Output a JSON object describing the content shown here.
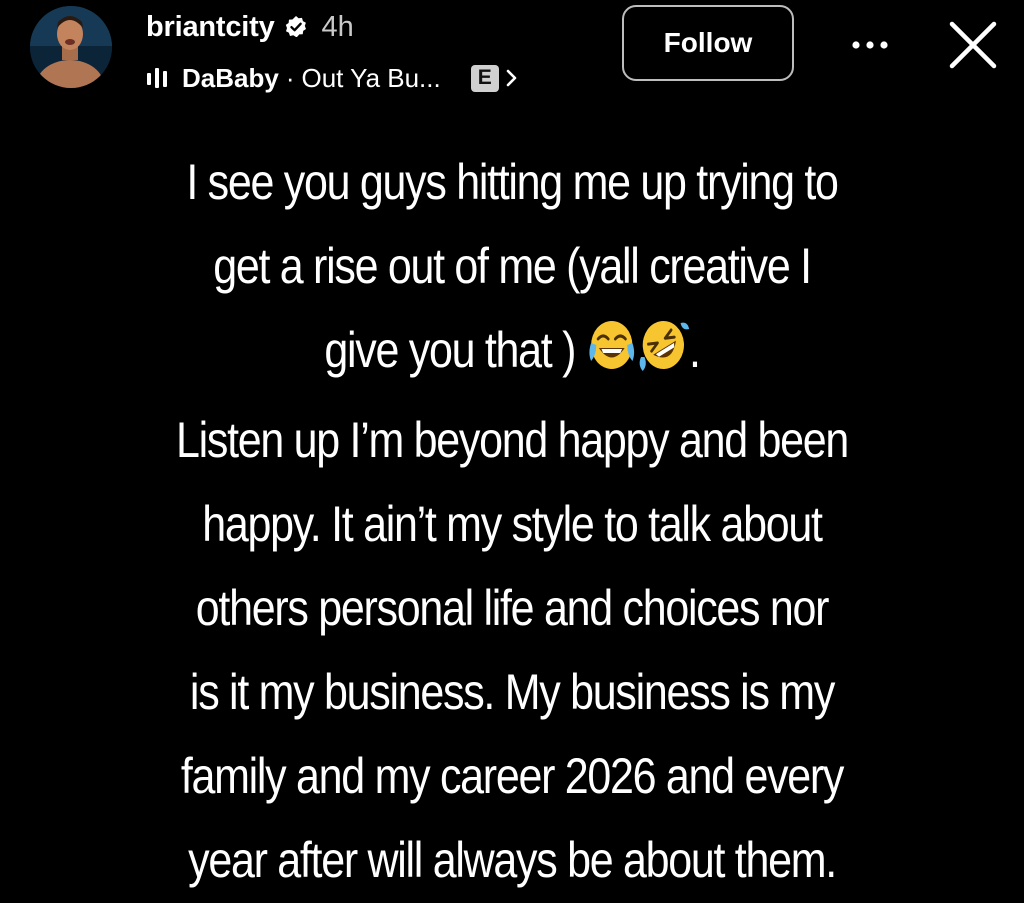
{
  "header": {
    "username": "briantcity",
    "time_ago": "4h",
    "follow_label": "Follow",
    "verified_icon": "verified-badge-icon",
    "more_icon": "more-options-icon",
    "close_icon": "close-icon"
  },
  "music": {
    "icon": "music-bars-icon",
    "artist": "DaBaby",
    "separator": "·",
    "track": "Out Ya Bu...",
    "explicit_badge": "E",
    "chevron_icon": "chevron-right-icon"
  },
  "story": {
    "lines": [
      "I see you guys hitting me up trying to",
      "get a rise out of me (yall creative I",
      "give you that )",
      "Listen up I’m beyond happy and been",
      "happy. It ain’t my style to talk about",
      "others personal life and choices nor",
      "is it my business. My business is my",
      "family and my career 2026 and every",
      "year after will always be about them."
    ],
    "line3_suffix": ".",
    "emojis": [
      "face-with-tears-of-joy",
      "rolling-on-the-floor-laughing"
    ]
  },
  "colors": {
    "background": "#000000",
    "text": "#ffffff",
    "secondary_text": "#c9c9c9",
    "follow_border": "#bdbdbd",
    "emoji_yellow": "#f7c530"
  }
}
